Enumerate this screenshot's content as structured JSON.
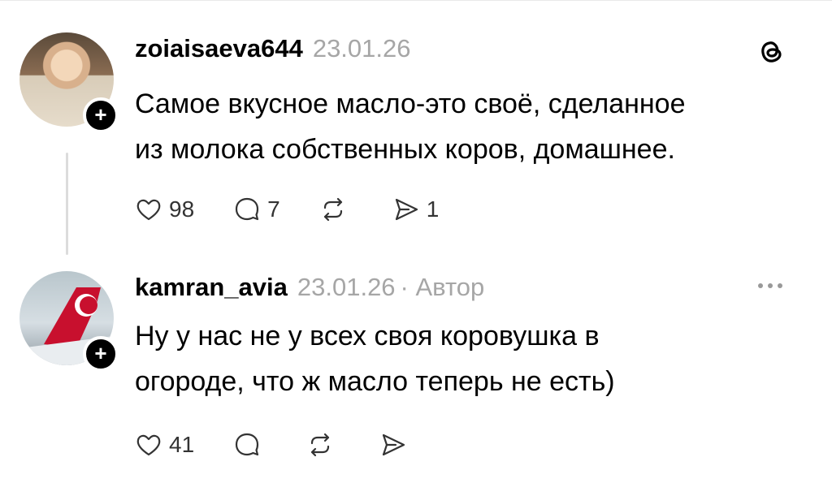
{
  "posts": [
    {
      "username": "zoiaisaeva644",
      "date": "23.01.26",
      "author_tag": "",
      "text": "Самое вкусное масло-это своё, сделанное\nиз  молока собственных коров, домашнее.",
      "likes": "98",
      "replies": "7",
      "reposts": "",
      "shares": "1",
      "plus": "+",
      "avatar_icon": "user-photo-avatar",
      "header_icon": "threads-logo-icon"
    },
    {
      "username": "kamran_avia",
      "date": "23.01.26",
      "author_tag": "· Автор",
      "text": "Ну у нас не у всех своя коровушка в\nогороде, что ж масло теперь не есть)",
      "likes": "41",
      "replies": "",
      "reposts": "",
      "shares": "",
      "plus": "+",
      "avatar_icon": "airplane-tail-avatar",
      "header_icon": "more-dots-icon"
    }
  ],
  "colors": {
    "text": "#000000",
    "meta": "#a6a6a6",
    "badge": "#000000",
    "thread_line": "#dcdcdc"
  }
}
